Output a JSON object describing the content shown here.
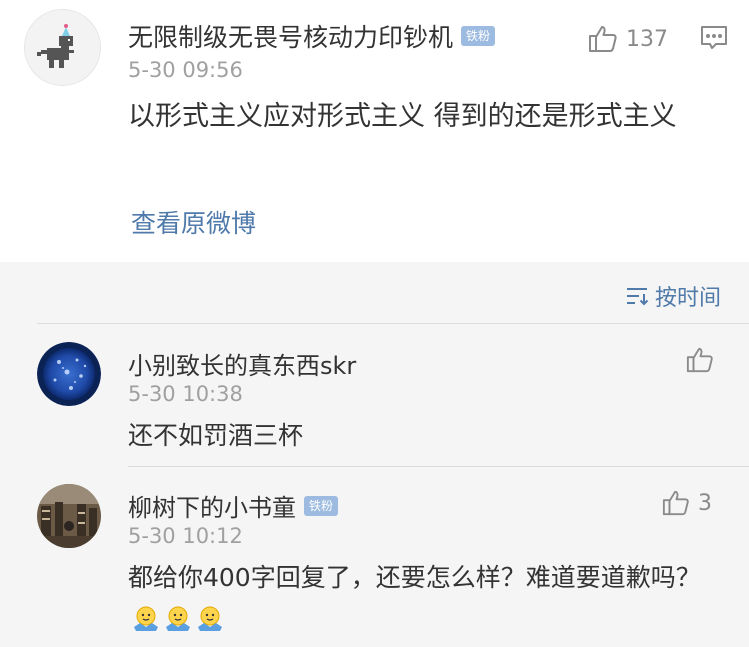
{
  "post": {
    "username": "无限制级无畏号核动力印钞机",
    "badge": "铁粉",
    "time": "5-30 09:56",
    "likes": "137",
    "text": "以形式主义应对形式主义 得到的还是形式主义",
    "view_link": "查看原微博",
    "icons": {
      "avatar": "dinosaur-avatar",
      "like": "thumbs-up-icon",
      "comment": "comment-icon"
    }
  },
  "sort": {
    "label": "按时间",
    "icon": "sort-icon"
  },
  "replies": [
    {
      "username": "小别致长的真东西skr",
      "badge": "",
      "time": "5-30 10:38",
      "text": "还不如罚酒三杯",
      "likes": ""
    },
    {
      "username": "柳树下的小书童",
      "badge": "铁粉",
      "time": "5-30 10:12",
      "text": "都给你400字回复了，还要怎么样？难道要道歉吗？",
      "likes": "3",
      "emoji": "shrug-emoji"
    }
  ],
  "colors": {
    "link": "#4f7aa9",
    "badge": "#9dbbe0",
    "time": "#a0a0a0",
    "background": "#f5f5f5"
  }
}
